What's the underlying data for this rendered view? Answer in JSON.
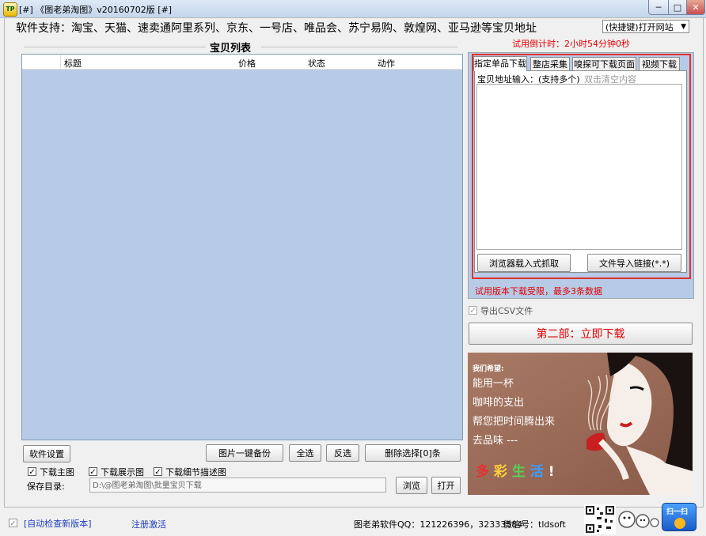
{
  "window": {
    "title": "[#] 《图老弟淘图》v20160702版 [#]",
    "app_icon_text": "TP",
    "minimize_glyph": "─",
    "maximize_glyph": "□",
    "close_glyph": "✕"
  },
  "header": {
    "support_text": "软件支持：淘宝、天猫、速卖通阿里系列、京东、一号店、唯品会、苏宁易购、敦煌网、亚马逊等宝贝地址",
    "shortcut_select_value": "(快捷键)打开网站",
    "trial_countdown": "试用倒计时：2小时54分钟0秒"
  },
  "list": {
    "group_title": "宝贝列表",
    "columns": [
      "标题",
      "价格",
      "状态",
      "动作"
    ],
    "rows": []
  },
  "actions": {
    "settings": "软件设置",
    "backup": "图片一键备份",
    "select_all": "全选",
    "invert": "反选",
    "delete_selected": "删除选择[0]条",
    "browse": "浏览",
    "open": "打开"
  },
  "options": {
    "download_main": {
      "label": "下载主图",
      "checked": true
    },
    "download_display": {
      "label": "下载展示图",
      "checked": true
    },
    "download_detail": {
      "label": "下载细节描述图",
      "checked": true
    },
    "save_dir_label": "保存目录:",
    "save_dir_value": "D:\\@图老弟淘图\\批量宝贝下载"
  },
  "right": {
    "tabs": [
      "指定单品下载",
      "整店采集",
      "嗅探可下载页面",
      "视频下载"
    ],
    "active_tab": 0,
    "url_label": "宝贝地址输入：(支持多个)",
    "url_hint": "双击清空内容",
    "btn_browser_capture": "浏览器载入式抓取",
    "btn_file_import": "文件导入链接(*.*)",
    "trial_limit": "试用版本下载受限，最多3条数据",
    "export_csv": {
      "label": "导出CSV文件",
      "checked": true
    },
    "download_now": "第二部：立即下载"
  },
  "ad": {
    "hope": "我们希望:",
    "lines": [
      "能用一杯",
      "咖啡的支出",
      "帮您把时间腾出来",
      "去品味 ---"
    ],
    "slogan": [
      "多",
      "彩",
      "生",
      "活",
      "!"
    ],
    "slogan_colors": [
      "#e63030",
      "#ffd23a",
      "#58d058",
      "#3aa0ff",
      "#ffffff"
    ]
  },
  "status": {
    "auto_check": {
      "label": "[自动检查新版本]",
      "checked": true
    },
    "register": "注册激活",
    "qq": "图老弟软件QQ：121226396，32333584",
    "wechat": "微信号：tldsoft",
    "scan": "扫一扫"
  }
}
